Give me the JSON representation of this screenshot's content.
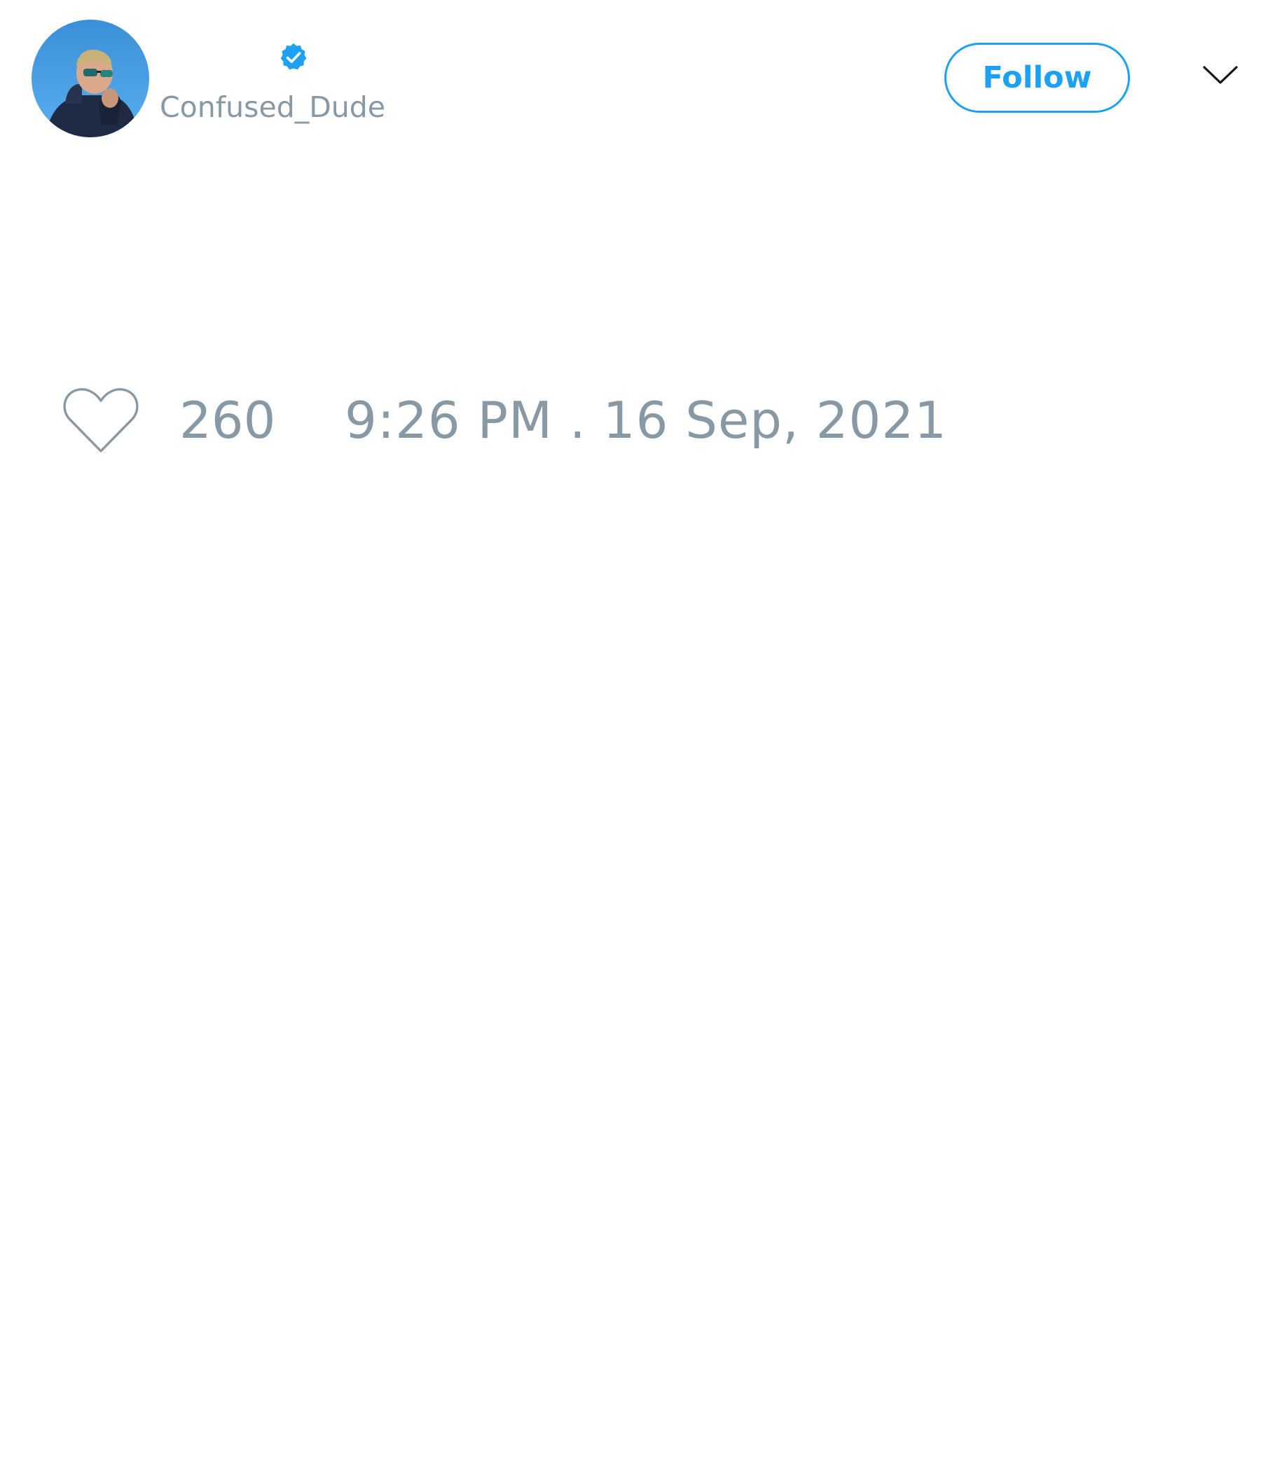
{
  "author": {
    "display_name": "",
    "handle": "Confused_Dude",
    "verified": true,
    "verified_color": "#1da1f2",
    "avatar_icon": "profile-photo"
  },
  "header": {
    "follow_label": "Follow",
    "menu_icon": "chevron-down-icon"
  },
  "tweet": {
    "text": ""
  },
  "footer": {
    "like_icon": "heart-outline-icon",
    "like_count": "260",
    "timestamp": "9:26 PM . 16 Sep, 2021"
  },
  "colors": {
    "accent": "#1da1f2",
    "muted_text": "#8899a6"
  }
}
